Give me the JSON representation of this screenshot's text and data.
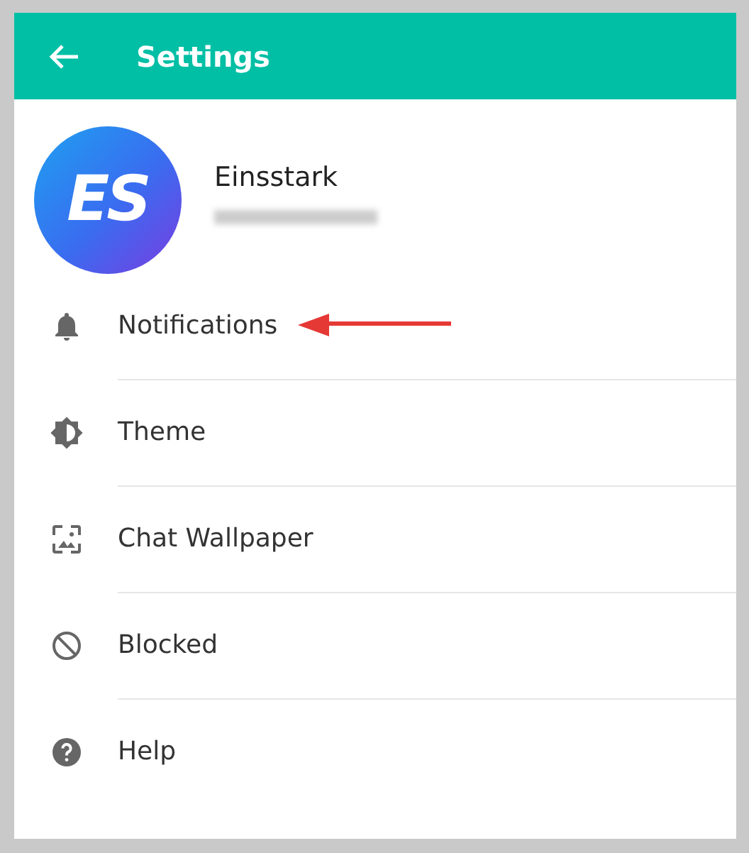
{
  "header": {
    "title": "Settings"
  },
  "profile": {
    "initials": "ES",
    "name": "Einsstark"
  },
  "menu": [
    {
      "kind": "bell",
      "label": "Notifications",
      "pointed": true
    },
    {
      "kind": "theme",
      "label": "Theme",
      "pointed": false
    },
    {
      "kind": "wallpaper",
      "label": "Chat Wallpaper",
      "pointed": false
    },
    {
      "kind": "blocked",
      "label": "Blocked",
      "pointed": false
    },
    {
      "kind": "help",
      "label": "Help",
      "pointed": false
    }
  ]
}
